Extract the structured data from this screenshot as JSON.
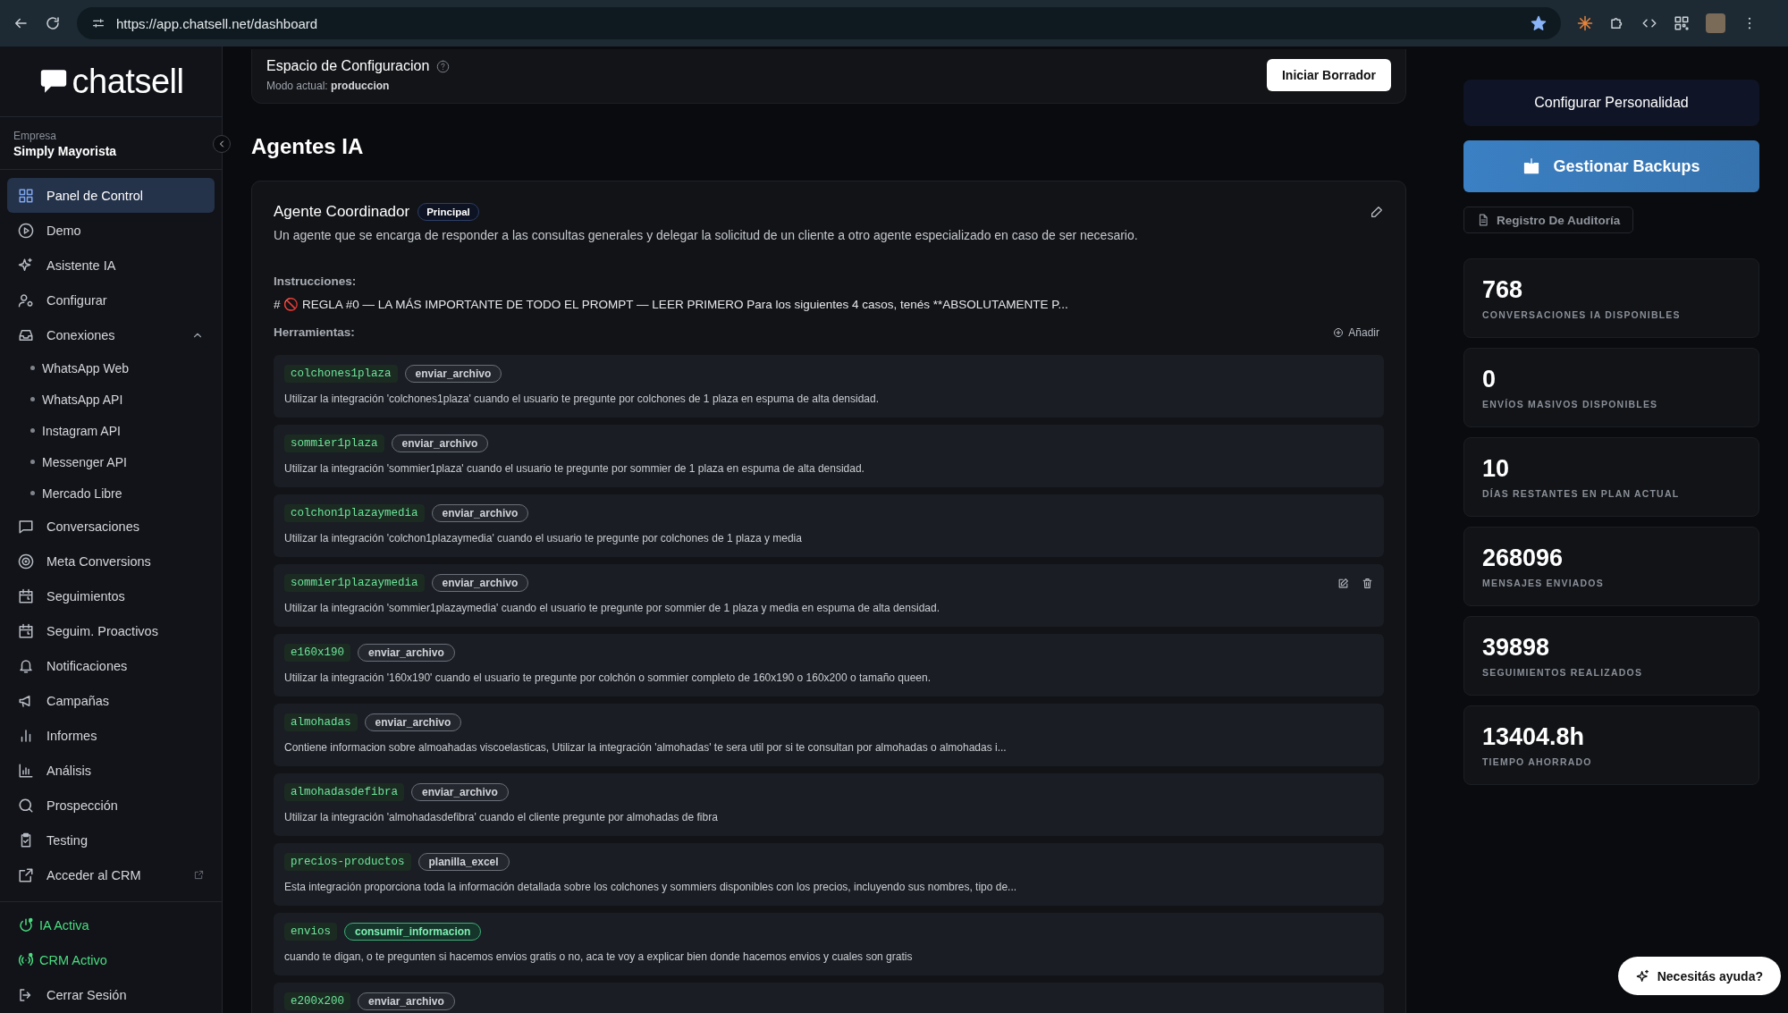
{
  "browser": {
    "url": "https://app.chatsell.net/dashboard"
  },
  "sidebar": {
    "logo": "chatsell",
    "company_label": "Empresa",
    "company": "Simply Mayorista",
    "items": [
      {
        "label": "Panel de Control",
        "selected": true
      },
      {
        "label": "Demo",
        "selected": false
      },
      {
        "label": "Asistente IA",
        "selected": false
      },
      {
        "label": "Configurar",
        "selected": false
      },
      {
        "label": "Conexiones",
        "selected": false,
        "expanded": true,
        "children": [
          {
            "label": "WhatsApp Web"
          },
          {
            "label": "WhatsApp API"
          },
          {
            "label": "Instagram API"
          },
          {
            "label": "Messenger API"
          },
          {
            "label": "Mercado Libre"
          }
        ]
      },
      {
        "label": "Conversaciones",
        "selected": false
      },
      {
        "label": "Meta Conversions",
        "selected": false
      },
      {
        "label": "Seguimientos",
        "selected": false
      },
      {
        "label": "Seguim. Proactivos",
        "selected": false
      },
      {
        "label": "Notificaciones",
        "selected": false
      },
      {
        "label": "Campañas",
        "selected": false
      },
      {
        "label": "Informes",
        "selected": false
      },
      {
        "label": "Análisis",
        "selected": false
      },
      {
        "label": "Prospección",
        "selected": false
      },
      {
        "label": "Testing",
        "selected": false
      },
      {
        "label": "Acceder al CRM",
        "selected": false,
        "external": true
      }
    ],
    "status": [
      {
        "label": "IA Activa",
        "on": true
      },
      {
        "label": "CRM Activo",
        "on": true
      }
    ],
    "logout": "Cerrar Sesión"
  },
  "config_space": {
    "title": "Espacio de Configuracion",
    "mode_label": "Modo actual:",
    "mode": "produccion",
    "button": "Iniciar Borrador"
  },
  "heading": "Agentes IA",
  "agent": {
    "name": "Agente Coordinador",
    "badge": "Principal",
    "description": "Un agente que se encarga de responder a las consultas generales y delegar la solicitud de un cliente a otro agente especializado en caso de ser necesario.",
    "instructions_label": "Instrucciones:",
    "instructions": "# 🚫 REGLA #0 — LA MÁS IMPORTANTE DE TODO EL PROMPT — LEER PRIMERO Para los siguientes 4 casos, tenés **ABSOLUTAMENTE P...",
    "tools_label": "Herramientas:",
    "add_button": "Añadir",
    "tools": [
      {
        "name": "colchones1plaza",
        "tag": "enviar_archivo",
        "highlighted": false,
        "hovered": false,
        "description": "Utilizar la integración 'colchones1plaza' cuando el usuario te pregunte por colchones de 1 plaza en espuma de alta densidad."
      },
      {
        "name": "sommier1plaza",
        "tag": "enviar_archivo",
        "highlighted": false,
        "hovered": false,
        "description": "Utilizar la integración 'sommier1plaza' cuando el usuario te pregunte por sommier de 1 plaza en espuma de alta densidad."
      },
      {
        "name": "colchon1plazaymedia",
        "tag": "enviar_archivo",
        "highlighted": false,
        "hovered": false,
        "description": "Utilizar la integración 'colchon1plazaymedia' cuando el usuario te pregunte por colchones de 1 plaza y media"
      },
      {
        "name": "sommier1plazaymedia",
        "tag": "enviar_archivo",
        "highlighted": false,
        "hovered": true,
        "description": "Utilizar la integración 'sommier1plazaymedia' cuando el usuario te pregunte por sommier de 1 plaza y media en espuma de alta densidad."
      },
      {
        "name": "e160x190",
        "tag": "enviar_archivo",
        "highlighted": false,
        "hovered": false,
        "description": "Utilizar la integración '160x190' cuando el usuario te pregunte por colchón o sommier completo de 160x190 o 160x200 o tamaño queen."
      },
      {
        "name": "almohadas",
        "tag": "enviar_archivo",
        "highlighted": false,
        "hovered": false,
        "description": "Contiene informacion sobre almoahadas viscoelasticas, Utilizar la integración 'almohadas' te sera util por si te consultan por almohadas o almohadas i..."
      },
      {
        "name": "almohadasdefibra",
        "tag": "enviar_archivo",
        "highlighted": false,
        "hovered": false,
        "description": "Utilizar la integración 'almohadasdefibra' cuando el cliente pregunte por almohadas de fibra"
      },
      {
        "name": "precios-productos",
        "tag": "planilla_excel",
        "highlighted": false,
        "hovered": false,
        "description": "Esta integración proporciona toda la información detallada sobre los colchones y sommiers disponibles con los precios, incluyendo sus nombres, tipo de..."
      },
      {
        "name": "envios",
        "tag": "consumir_informacion",
        "highlighted": true,
        "hovered": false,
        "description": "cuando te digan, o te pregunten si hacemos envios gratis o no, aca te voy a explicar bien donde hacemos envios y cuales son gratis"
      },
      {
        "name": "e200x200",
        "tag": "enviar_archivo",
        "highlighted": false,
        "hovered": false
      }
    ]
  },
  "right": {
    "personality_button": "Configurar Personalidad",
    "backups_button": "Gestionar Backups",
    "audit_button": "Registro De Auditoría",
    "stats": [
      {
        "value": "768",
        "label": "CONVERSACIONES IA DISPONIBLES"
      },
      {
        "value": "0",
        "label": "ENVÍOS MASIVOS DISPONIBLES"
      },
      {
        "value": "10",
        "label": "DÍAS RESTANTES EN PLAN ACTUAL"
      },
      {
        "value": "268096",
        "label": "MENSAJES ENVIADOS"
      },
      {
        "value": "39898",
        "label": "SEGUIMIENTOS REALIZADOS"
      },
      {
        "value": "13404.8h",
        "label": "TIEMPO AHORRADO"
      }
    ],
    "help_button": "Necesitás ayuda?"
  }
}
